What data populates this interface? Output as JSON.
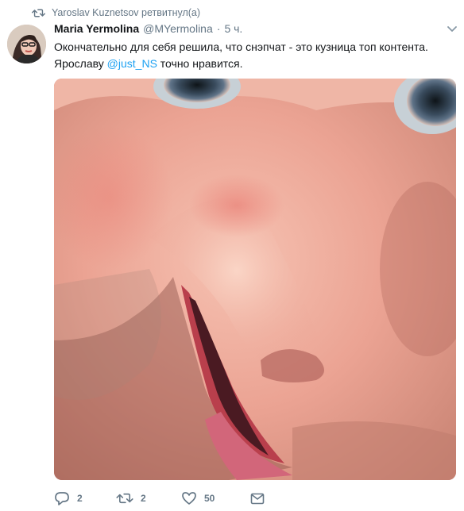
{
  "retweet_context": {
    "icon": "retweet-icon",
    "text": "Yaroslav Kuznetsov ретвитнул(а)"
  },
  "tweet": {
    "display_name": "Maria Yermolina",
    "handle": "@MYermolina",
    "separator": "·",
    "timestamp": "5 ч.",
    "text_line1": "Окончательно для себя решила, что снэпчат - это кузница топ контента.",
    "text_line2_before": "Ярославу",
    "mention": "@just_NS",
    "text_line2_after": "точно нравится."
  },
  "actions": {
    "reply_count": "2",
    "retweet_count": "2",
    "like_count": "50"
  },
  "colors": {
    "accent": "#1da1f2",
    "muted": "#657786",
    "text": "#14171a"
  }
}
